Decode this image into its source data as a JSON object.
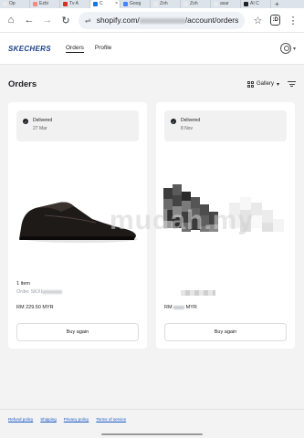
{
  "browser": {
    "tabs": [
      {
        "label": "Op",
        "color": "#e8eaed"
      },
      {
        "label": "Ezbi",
        "color": "#f28b82"
      },
      {
        "label": "Tv A",
        "color": "#d93025"
      },
      {
        "label": "C",
        "color": "#1a73e8",
        "active": true
      },
      {
        "label": "Goog",
        "color": "#4285f4"
      },
      {
        "label": "Zoh",
        "color": "#e8eaed"
      },
      {
        "label": "Zoh",
        "color": "#e8eaed"
      },
      {
        "label": "asar",
        "color": "#e8eaed"
      },
      {
        "label": "AI C",
        "color": "#202124"
      }
    ],
    "url_prefix": "shopify.com/",
    "url_suffix": "/account/orders",
    "tab_count": ":D"
  },
  "site": {
    "logo": "SKECHERS",
    "nav": [
      {
        "label": "Orders",
        "active": true
      },
      {
        "label": "Profile",
        "active": false
      }
    ]
  },
  "page": {
    "title": "Orders",
    "view_label": "Gallery"
  },
  "orders": [
    {
      "status": "Delivered",
      "date": "27 Mar",
      "items": "1 item",
      "order_prefix": "Order SKXI",
      "price": "RM 229.50 MYR",
      "button": "Buy again"
    },
    {
      "status": "Delivered",
      "date": "8 Nov",
      "price_prefix": "RM",
      "price_suffix": "MYR",
      "button": "Buy again"
    }
  ],
  "watermark": "mudah.my",
  "footer": {
    "links": [
      "Refund policy",
      "Shipping",
      "Privacy policy",
      "Terms of service"
    ]
  }
}
